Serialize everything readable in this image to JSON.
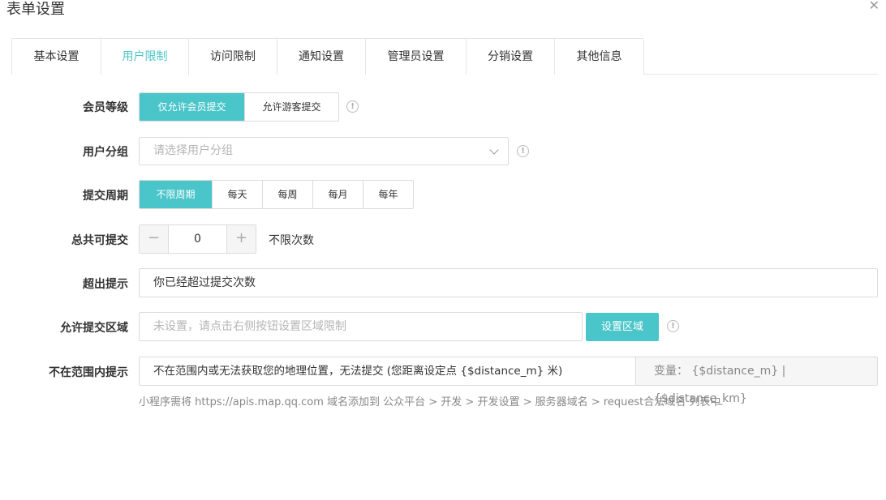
{
  "dialog": {
    "title": "表单设置",
    "close": "✕"
  },
  "tabs": [
    "基本设置",
    "用户限制",
    "访问限制",
    "通知设置",
    "管理员设置",
    "分销设置",
    "其他信息"
  ],
  "form": {
    "member_level": {
      "label": "会员等级",
      "options": [
        "仅允许会员提交",
        "允许游客提交"
      ],
      "selected": "仅允许会员提交"
    },
    "user_group": {
      "label": "用户分组",
      "placeholder": "请选择用户分组"
    },
    "submit_cycle": {
      "label": "提交周期",
      "options": [
        "不限周期",
        "每天",
        "每周",
        "每月",
        "每年"
      ],
      "selected": "不限周期"
    },
    "total_submits": {
      "label": "总共可提交",
      "minus": "−",
      "plus": "+",
      "value": "0",
      "note": "不限次数"
    },
    "over_tip": {
      "label": "超出提示",
      "value": "你已经超过提交次数"
    },
    "allowed_region": {
      "label": "允许提交区域",
      "placeholder": "未设置，请点击右侧按钮设置区域限制",
      "button": "设置区域"
    },
    "out_of_range_tip": {
      "label": "不在范围内提示",
      "value": "不在范围内或无法获取您的地理位置，无法提交 (您距离设定点 {$distance_m} 米)",
      "addon": "变量：  {$distance_m} | {$distance_km}",
      "help": "小程序需将 https://apis.map.qq.com 域名添加到 公众平台 > 开发 > 开发设置 > 服务器域名 > request合法域名 列表中"
    }
  },
  "colors": {
    "accent": "#4ac5c9",
    "border": "#dcdcdc"
  },
  "icons": {
    "info": "info-circle-icon",
    "close": "close-icon",
    "dropdown": "chevron-down-icon"
  }
}
